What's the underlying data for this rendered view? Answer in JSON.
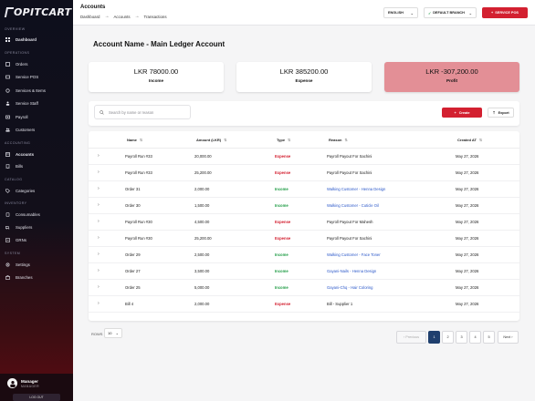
{
  "brand": {
    "name": "OPITCART"
  },
  "sidebar": {
    "sections": {
      "overview": "OVERVIEW",
      "operations": "OPERATIONS",
      "accounting": "ACCOUNTING",
      "catalog": "CATALOG",
      "inventory": "INVENTORY",
      "system": "SYSTEM"
    },
    "items": {
      "dashboard": "Dashboard",
      "orders": "Orders",
      "service_pos": "Service POS",
      "services_items": "Services & Items",
      "service_staff": "Service Staff",
      "payroll": "Payroll",
      "customers": "Customers",
      "accounts": "Accounts",
      "bills": "Bills",
      "categories": "Categories",
      "consumables": "Consumables",
      "suppliers": "Suppliers",
      "grns": "GRNs",
      "settings": "Settings",
      "branches": "Branches"
    },
    "user": {
      "name": "Manager",
      "role": "MANAGER",
      "pill": "LOG OUT"
    }
  },
  "header": {
    "title": "Accounts",
    "breadcrumb": [
      "Dashboard",
      "Accounts",
      "Transactions"
    ],
    "language": "ENGLISH",
    "branch": "DEFAULT BRANCH",
    "service_pos_button": "SERVICE POS"
  },
  "page": {
    "title": "Account Name - Main Ledger Account"
  },
  "summary": {
    "income": {
      "amount": "LKR 78000.00",
      "label": "Income"
    },
    "expense": {
      "amount": "LKR 385200.00",
      "label": "Expense"
    },
    "profit": {
      "amount": "LKR -307,200.00",
      "label": "Profit"
    }
  },
  "toolbar": {
    "search_placeholder": "Search by name or reason",
    "create": "Create",
    "export": "Export"
  },
  "colors": {
    "accent": "#d32030",
    "expense": "#d32030",
    "income": "#1f9c45",
    "link": "#2a57c9",
    "pagination_active": "#1f3f6e"
  },
  "table": {
    "columns": {
      "name": "Name",
      "amount": "Amount (LKR)",
      "type": "Type",
      "reason": "Reason",
      "created": "Created AT"
    },
    "rows": [
      {
        "name": "Payroll Run #33",
        "amount": "20,000.00",
        "type": "Expense",
        "reason": "Payroll Payout For Sachini",
        "date": "May 27, 2026"
      },
      {
        "name": "Payroll Run #33",
        "amount": "25,200.00",
        "type": "Expense",
        "reason": "Payroll Payout For Sachini",
        "date": "May 27, 2026"
      },
      {
        "name": "Order 31",
        "amount": "2,000.00",
        "type": "Income",
        "reason": "Walking Customer - Henna Design",
        "date": "May 27, 2026"
      },
      {
        "name": "Order 30",
        "amount": "1,500.00",
        "type": "Income",
        "reason": "Walking Customer - Cuticle Oil",
        "date": "May 27, 2026"
      },
      {
        "name": "Payroll Run #30",
        "amount": "4,500.00",
        "type": "Expense",
        "reason": "Payroll Payout For Mahesh",
        "date": "May 27, 2026"
      },
      {
        "name": "Payroll Run #30",
        "amount": "25,200.00",
        "type": "Expense",
        "reason": "Payroll Payout For Sachini",
        "date": "May 27, 2026"
      },
      {
        "name": "Order 29",
        "amount": "2,500.00",
        "type": "Income",
        "reason": "Walking Customer - Face Toner",
        "date": "May 27, 2026"
      },
      {
        "name": "Order 27",
        "amount": "3,500.00",
        "type": "Income",
        "reason": "Gayani-Nails - Henna Design",
        "date": "May 27, 2026"
      },
      {
        "name": "Order 25",
        "amount": "5,000.00",
        "type": "Income",
        "reason": "Gayani-Chq - Hair Coloring",
        "date": "May 27, 2026"
      },
      {
        "name": "Bill 4",
        "amount": "2,000.00",
        "type": "Expense",
        "reason": "Bill - Supplier 1",
        "date": "May 27, 2026"
      }
    ]
  },
  "pagination": {
    "rows_label": "ROWS",
    "rows_per_page": "10",
    "previous": "‹ Previous",
    "pages": [
      "1",
      "2",
      "3",
      "4",
      "5"
    ],
    "next": "Next ›"
  }
}
